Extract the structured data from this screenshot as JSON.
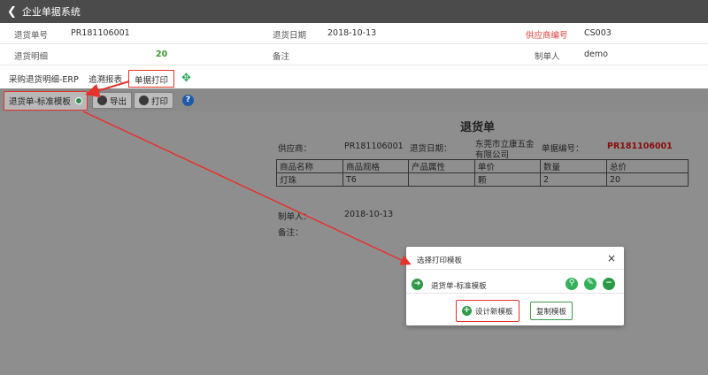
{
  "app": {
    "title": "企业单据系统"
  },
  "form": {
    "return_no_label": "退货单号",
    "return_no": "PR181106001",
    "return_date_label": "退货日期",
    "return_date": "2018-10-13",
    "supplier_code_label": "供应商编号",
    "supplier_code": "CS003",
    "detail_label": "退货明细",
    "detail_count": "20",
    "remark_label": "备注",
    "remark": "",
    "creator_label": "制单人",
    "creator": "demo"
  },
  "tabs": [
    "采购退货明细-ERP",
    "追溯报表",
    "单据打印"
  ],
  "toolbar": {
    "template": "退货单-标准模板",
    "export": "导出",
    "print": "打印",
    "help": "?"
  },
  "doc": {
    "title": "退货单",
    "supplier_label": "供应商：",
    "supplier_value": "PR181106001",
    "date_label": "退货日期：",
    "company": [
      "东莞市立康五金",
      "有限公司"
    ],
    "docno_label": "单据编号：",
    "docno_value": "PR181106001",
    "headers": [
      "商品名称",
      "商品规格",
      "产品属性",
      "单价",
      "数量",
      "总价"
    ],
    "rows": [
      [
        "灯珠",
        "T6",
        "",
        "颗",
        "2",
        "20"
      ]
    ],
    "creator_label": "制单人：",
    "created_date": "2018-10-13",
    "remark_label": "备注："
  },
  "dialog": {
    "title": "选择打印模板",
    "close": "×",
    "item": "退货单-标准模板",
    "design_button": "设计新模板",
    "copy_button": "复制模板"
  },
  "colors": {
    "highlight": "#e5322c",
    "overlay": "#8e8e8e",
    "green": "#2f9a47"
  }
}
